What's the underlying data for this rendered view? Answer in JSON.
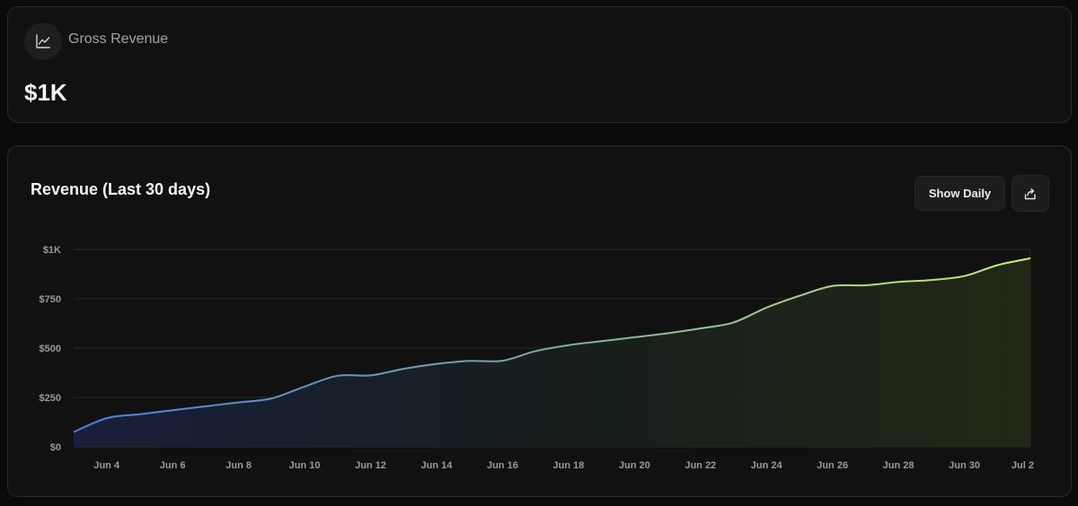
{
  "summary": {
    "icon": "line-chart-icon",
    "label": "Gross Revenue",
    "value": "$1K"
  },
  "chart_card": {
    "title": "Revenue (Last 30 days)",
    "show_daily_label": "Show Daily",
    "share_icon": "share-icon"
  },
  "colors": {
    "line_start": "#4f7ee0",
    "line_end": "#c4f27a",
    "grid": "#2a2a2a",
    "card_bg": "#111111"
  },
  "chart_data": {
    "type": "area",
    "title": "Revenue (Last 30 days)",
    "xlabel": "",
    "ylabel": "",
    "ylim": [
      0,
      1000
    ],
    "y_ticks": [
      0,
      250,
      500,
      750,
      1000
    ],
    "y_tick_labels": [
      "$0",
      "$250",
      "$500",
      "$750",
      "$1K"
    ],
    "x_tick_labels": [
      "Jun 4",
      "Jun 6",
      "Jun 8",
      "Jun 10",
      "Jun 12",
      "Jun 14",
      "Jun 16",
      "Jun 18",
      "Jun 20",
      "Jun 22",
      "Jun 24",
      "Jun 26",
      "Jun 28",
      "Jun 30",
      "Jul 2"
    ],
    "grid": true,
    "legend": "none",
    "x": [
      "Jun 3",
      "Jun 4",
      "Jun 5",
      "Jun 6",
      "Jun 7",
      "Jun 8",
      "Jun 9",
      "Jun 10",
      "Jun 11",
      "Jun 12",
      "Jun 13",
      "Jun 14",
      "Jun 15",
      "Jun 16",
      "Jun 17",
      "Jun 18",
      "Jun 19",
      "Jun 20",
      "Jun 21",
      "Jun 22",
      "Jun 23",
      "Jun 24",
      "Jun 25",
      "Jun 26",
      "Jun 27",
      "Jun 28",
      "Jun 29",
      "Jun 30",
      "Jul 1",
      "Jul 2"
    ],
    "values": [
      75,
      145,
      165,
      185,
      205,
      225,
      245,
      305,
      360,
      362,
      395,
      420,
      435,
      436,
      485,
      515,
      535,
      555,
      575,
      600,
      630,
      705,
      765,
      815,
      818,
      835,
      845,
      865,
      920,
      955
    ]
  }
}
